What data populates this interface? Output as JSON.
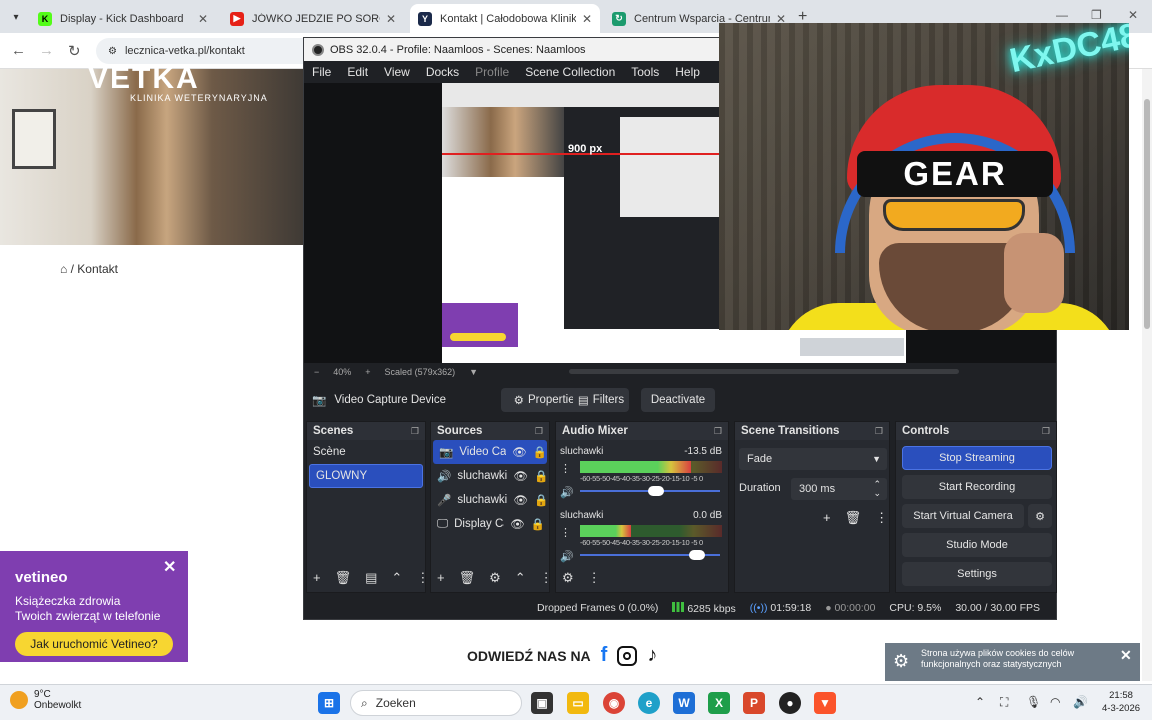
{
  "browser": {
    "tabs": [
      {
        "title": "Display - Kick Dashboard",
        "fav": "K",
        "color": "#53fc18"
      },
      {
        "title": "JÓWKO JEDZIE PO SOROKO! - ...",
        "fav": "▶",
        "color": "#e62117"
      },
      {
        "title": "Kontakt | Całodobowa Klinika W...",
        "fav": "Y",
        "color": "#1b2a4a"
      },
      {
        "title": "Centrum Wsparcia - Centrum W...",
        "fav": "↻",
        "color": "#1c9b6e"
      }
    ],
    "url": "lecznica-vetka.pl/kontakt"
  },
  "site": {
    "logo": "VETKA",
    "logo_sub": "KLINIKA WETERYNARYJNA",
    "breadcrumb": "/ Kontakt",
    "social_label": "ODWIEDŹ NAS NA",
    "ad": {
      "brand": "vetineo",
      "line1": "Książeczka zdrowia",
      "line2": "Twoich zwierząt w telefonie",
      "cta": "Jak uruchomić Vetineo?"
    },
    "cookie_text": "Strona używa plików cookies do celów funkcjonalnych oraz statystycznych"
  },
  "obs": {
    "title": "OBS 32.0.4 - Profile: Naamloos - Scenes: Naamloos",
    "menu": [
      "File",
      "Edit",
      "View",
      "Docks",
      "Profile",
      "Scene Collection",
      "Tools",
      "Help"
    ],
    "preview_marker": "900 px",
    "zoom": "40%",
    "scaled": "Scaled (579x362)",
    "source_name": "Video Capture Device",
    "buttons": {
      "properties": "Properties",
      "filters": "Filters",
      "deactivate": "Deactivate"
    },
    "docks": {
      "scenes": "Scenes",
      "sources": "Sources",
      "mixer": "Audio Mixer",
      "transitions": "Scene Transitions",
      "controls": "Controls"
    },
    "scenes": [
      "Scène",
      "GLOWNY"
    ],
    "sources": [
      "Video Cap",
      "sluchawki",
      "sluchawki",
      "Display Ca"
    ],
    "mixer": [
      {
        "name": "sluchawki",
        "db": "-13.5 dB",
        "level": 0.78,
        "fader": 0.55
      },
      {
        "name": "sluchawki",
        "db": "0.0 dB",
        "level": 0.36,
        "fader": 0.88
      }
    ],
    "meter_ticks": "-60-55-50-45-40-35-30-25-20-15-10 -5 0",
    "transition": {
      "type": "Fade",
      "duration_label": "Duration",
      "duration": "300 ms"
    },
    "controls": [
      "Stop Streaming",
      "Start Recording",
      "Start Virtual Camera",
      "Studio Mode",
      "Settings"
    ],
    "status": {
      "dropped": "Dropped Frames 0 (0.0%)",
      "bitrate": "6285 kbps",
      "stream_time": "01:59:18",
      "rec_time": "00:00:00",
      "cpu": "CPU: 9.5%",
      "fps": "30.00 / 30.00 FPS"
    }
  },
  "webcam": {
    "cap_text": "GEAR",
    "neon_text": "KxDC48"
  },
  "taskbar": {
    "temp": "9°C",
    "weather": "Onbewolkt",
    "search": "Zoeken",
    "time": "21:58",
    "date": "4-3-2026"
  }
}
